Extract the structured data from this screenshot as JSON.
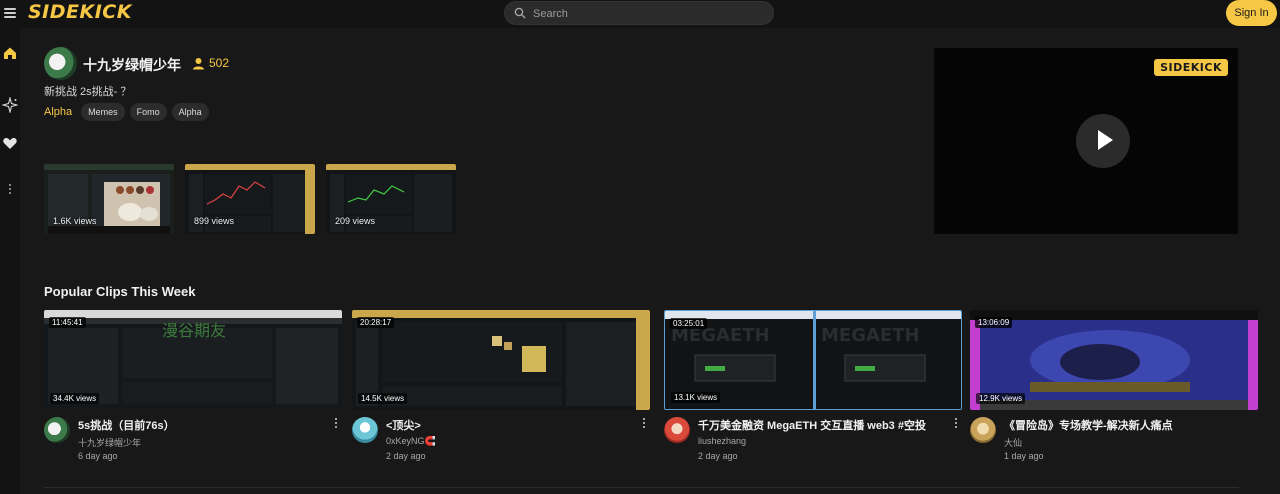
{
  "brand": {
    "logo": "SIDEKICK",
    "accent": "#f6c744"
  },
  "search": {
    "placeholder": "Search"
  },
  "header": {
    "signin_label": "Sign In"
  },
  "sidebar": {
    "items": [
      "home-icon",
      "sparkle-icon",
      "heart-icon",
      "more-icon"
    ]
  },
  "stream": {
    "streamer_name": "十九岁绿帽少年",
    "viewer_count": "502",
    "title": "新挑战 2s挑战- ？",
    "category": "Alpha",
    "tags": [
      "Memes",
      "Fomo",
      "Alpha"
    ]
  },
  "recent_clips": [
    {
      "views": "1.6K views"
    },
    {
      "views": "899 views"
    },
    {
      "views": "209 views"
    }
  ],
  "player": {
    "watermark": "SIDEKICK"
  },
  "popular": {
    "heading": "Popular Clips This Week",
    "clips": [
      {
        "duration": "11:45:41",
        "views": "34.4K views",
        "title": "5s挑战（目前76s）",
        "author": "十九岁绿帽少年",
        "age": "6 day ago"
      },
      {
        "duration": "20:28:17",
        "views": "14.5K views",
        "title": "<顶尖>",
        "author": "0xKeyNG🧲",
        "age": "2 day ago"
      },
      {
        "duration": "03:25:01",
        "views": "13.1K views",
        "title": "千万美金融资 MegaETH 交互直播 web3 #空投",
        "author": "liushezhang",
        "age": "2 day ago"
      },
      {
        "duration": "13:06:09",
        "views": "12.9K views",
        "title": "《冒险岛》专场教学-解决新人痛点",
        "author": "大仙",
        "age": "1 day ago"
      }
    ]
  }
}
